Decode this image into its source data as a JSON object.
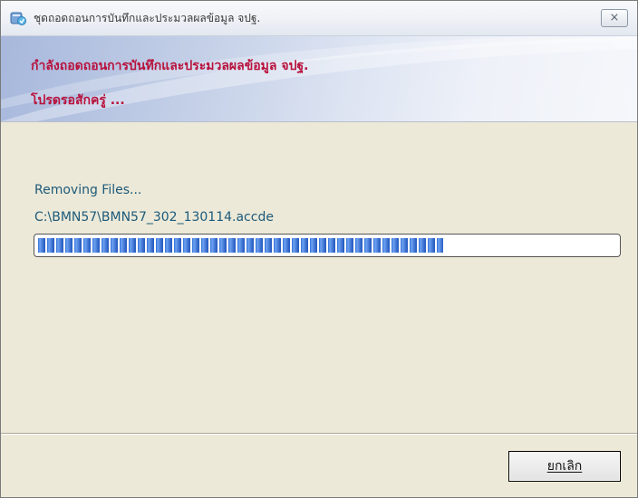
{
  "window": {
    "title": "ชุดถอดถอนการบันทึกและประมวลผลข้อมูล จปฐ.",
    "close_glyph": "⨯"
  },
  "header": {
    "line1": "กำลังถอดถอนการบันทึกและประมวลผลข้อมูล จปฐ.",
    "line2": "โปรดรอสักครู่ ..."
  },
  "status": {
    "action": "Removing Files...",
    "file": "C:\\BMN57\\BMN57_302_130114.accde"
  },
  "progress": {
    "percent": 70
  },
  "buttons": {
    "cancel_label": "ยกเลิก"
  },
  "colors": {
    "header_text": "#b8113c",
    "status_text": "#1d5a7a",
    "progress_fill": "#2f6fd6",
    "dialog_background": "#ece9d8"
  },
  "icons": {
    "app": "installer-app-icon",
    "close": "close-icon"
  }
}
